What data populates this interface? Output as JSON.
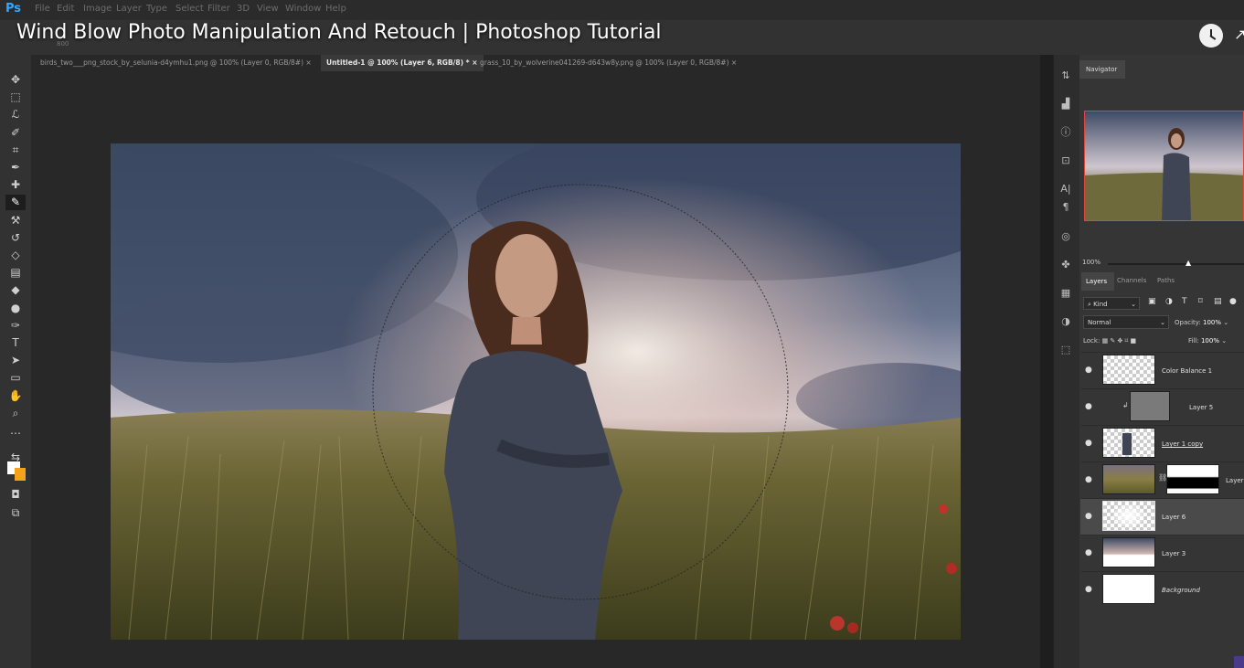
{
  "video_title": "Wind Blow Photo Manipulation And Retouch | Photoshop Tutorial",
  "app": {
    "logo": "Ps"
  },
  "menu": [
    "File",
    "Edit",
    "Image",
    "Layer",
    "Type",
    "Select",
    "Filter",
    "3D",
    "View",
    "Window",
    "Help"
  ],
  "options_bar": {
    "brush_size": "800"
  },
  "tabs": [
    {
      "label": "birds_two___png_stock_by_selunia-d4ymhu1.png @ 100% (Layer 0, RGB/8#)",
      "close": "×",
      "active": false
    },
    {
      "label": "Untitled-1 @ 100% (Layer 6, RGB/8) *",
      "close": "×",
      "active": true
    },
    {
      "label": "grass_10_by_wolverine041269-d643w8y.png @ 100% (Layer 0, RGB/8#)",
      "close": "×",
      "active": false
    }
  ],
  "tools": [
    "move-icon",
    "marquee-icon",
    "lasso-icon",
    "quick-select-icon",
    "crop-icon",
    "eyedropper-icon",
    "healing-icon",
    "brush-icon",
    "stamp-icon",
    "history-brush-icon",
    "eraser-icon",
    "gradient-icon",
    "blur-icon",
    "dodge-icon",
    "pen-icon",
    "type-icon",
    "path-select-icon",
    "rectangle-icon",
    "hand-icon",
    "zoom-icon",
    "more-icon"
  ],
  "colors": {
    "foreground": "#ffffff",
    "background": "#f4a21b",
    "accent": "#e0463a"
  },
  "navigator": {
    "tab": "Navigator",
    "zoom": "100%"
  },
  "layers_panel": {
    "tabs": [
      "Layers",
      "Channels",
      "Paths"
    ],
    "filter_kind": "Kind",
    "blend_mode": "Normal",
    "opacity_label": "Opacity:",
    "opacity_value": "100%",
    "lock_label": "Lock:",
    "fill_label": "Fill:",
    "fill_value": "100%",
    "layers": [
      {
        "name": "Color Balance 1",
        "visible": true,
        "selected": false
      },
      {
        "name": "Layer 5",
        "visible": true,
        "selected": false
      },
      {
        "name": "Layer 1 copy",
        "visible": true,
        "selected": false
      },
      {
        "name": "Layer",
        "visible": true,
        "selected": false
      },
      {
        "name": "Layer 6",
        "visible": true,
        "selected": true
      },
      {
        "name": "Layer 3",
        "visible": true,
        "selected": false
      },
      {
        "name": "Background",
        "visible": true,
        "selected": false
      }
    ]
  }
}
